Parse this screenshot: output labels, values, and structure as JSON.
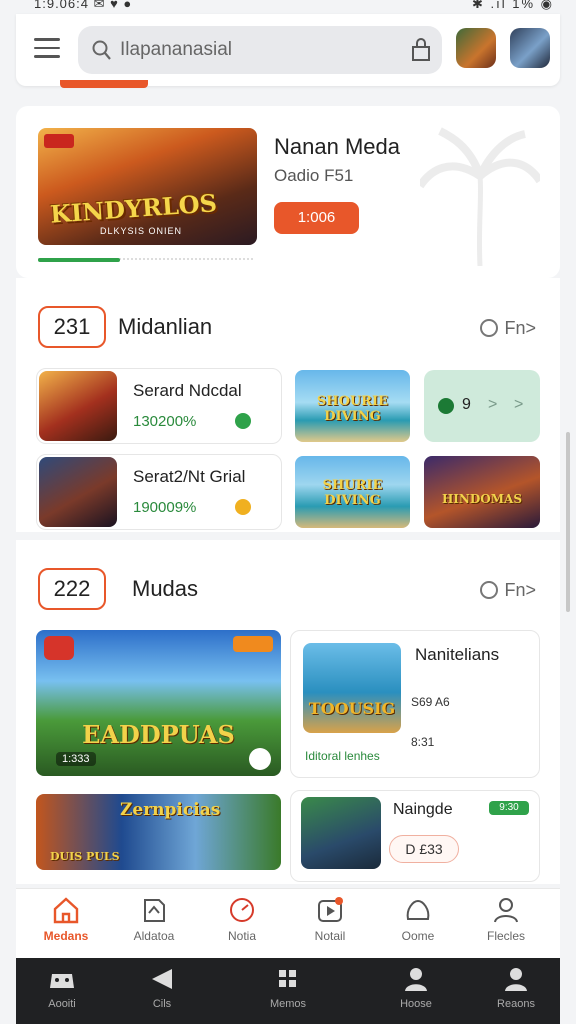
{
  "status_bar": {
    "left": "1:9.06:4 ✉ ♥ ●",
    "right": "✱ .ıl 1% ◉"
  },
  "search": {
    "placeholder": "Ilapananasial"
  },
  "hero": {
    "title": "Nanan Meda",
    "subtitle": "Oadio F51",
    "button": "1:006",
    "image_logo": "KINDYRLOS",
    "image_sub": "DLKYSIS ONIEN",
    "progress": 0.38
  },
  "section1": {
    "badge": "231",
    "title": "Midanlian",
    "more": "Fn>",
    "items": [
      {
        "title": "Serard Ndcdal",
        "value": "130200%",
        "dot_color": "#2fa24a"
      },
      {
        "title": "Serat2/Nt Grial",
        "value": "190009%",
        "dot_color": "#f0b020"
      }
    ],
    "tiles": [
      {
        "logo": "SHOURIE DIVING"
      },
      {
        "logo": "SHURIE DIVING"
      },
      {
        "logo": "HINDOMAS"
      }
    ],
    "mint": {
      "num": "9",
      "c1": ">",
      "c2": ">"
    }
  },
  "section2": {
    "badge": "222",
    "title": "Mudas",
    "more": "Fn>",
    "big_logo": "EADDPUAS",
    "big_tag": "1:333",
    "card1": {
      "title": "Nanitelians",
      "logo": "TOOUSIG",
      "price1": "S69 A6",
      "price2": "8:31",
      "link": "Iditoral lenhes"
    },
    "card2": {
      "title": "Naingde",
      "badge": "9:30",
      "button": "D £33"
    },
    "banner": {
      "logo": "Zernpicias",
      "logo2": "DUIS PULS"
    }
  },
  "tabs": [
    {
      "label": "Medans",
      "icon": "home-icon",
      "active": true
    },
    {
      "label": "Aldatoa",
      "icon": "document-icon",
      "active": false
    },
    {
      "label": "Notia",
      "icon": "gauge-icon",
      "active": false
    },
    {
      "label": "Notail",
      "icon": "video-icon",
      "active": false
    },
    {
      "label": "Oome",
      "icon": "cloud-icon",
      "active": false
    },
    {
      "label": "Flecles",
      "icon": "person-icon",
      "active": false
    }
  ],
  "nav": [
    {
      "label": "Aooiti",
      "icon": "gamepad-icon"
    },
    {
      "label": "Cils",
      "icon": "back-icon"
    },
    {
      "label": "Memos",
      "icon": "grid-icon"
    },
    {
      "label": "Hoose",
      "icon": "person-icon"
    },
    {
      "label": "Reaons",
      "icon": "person-icon"
    }
  ],
  "colors": {
    "accent": "#e8572a",
    "green": "#2fa24a",
    "navbar": "#202123"
  }
}
